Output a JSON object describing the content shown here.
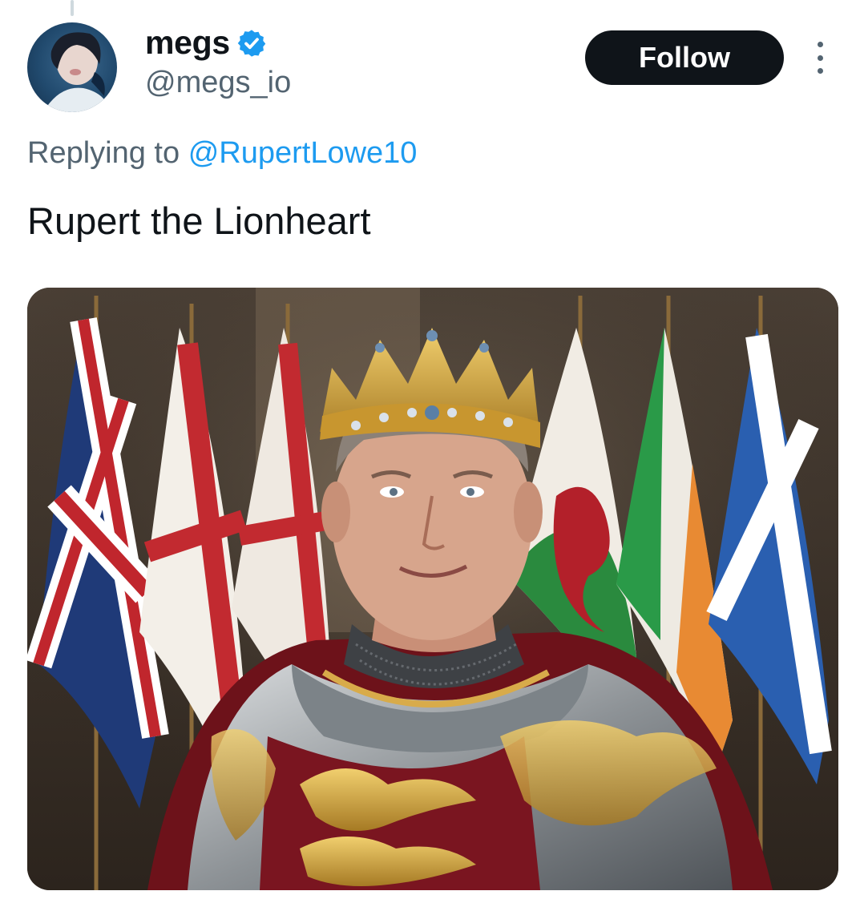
{
  "tweet": {
    "author": {
      "display_name": "megs",
      "handle": "@megs_io",
      "verified": true,
      "avatar_icon": "user-avatar"
    },
    "follow_label": "Follow",
    "more_icon": "more-options-icon",
    "replying_prefix": "Replying to",
    "replying_to": "@RupertLowe10",
    "text": "Rupert the Lionheart",
    "media": {
      "type": "image",
      "subject": "crowned man in ornate plate armor with lion emblems before a row of flags"
    }
  },
  "colors": {
    "text_primary": "#0f1419",
    "text_secondary": "#536471",
    "link": "#1d9bf0",
    "verified_badge": "#1d9bf0",
    "follow_bg": "#0f1419"
  }
}
